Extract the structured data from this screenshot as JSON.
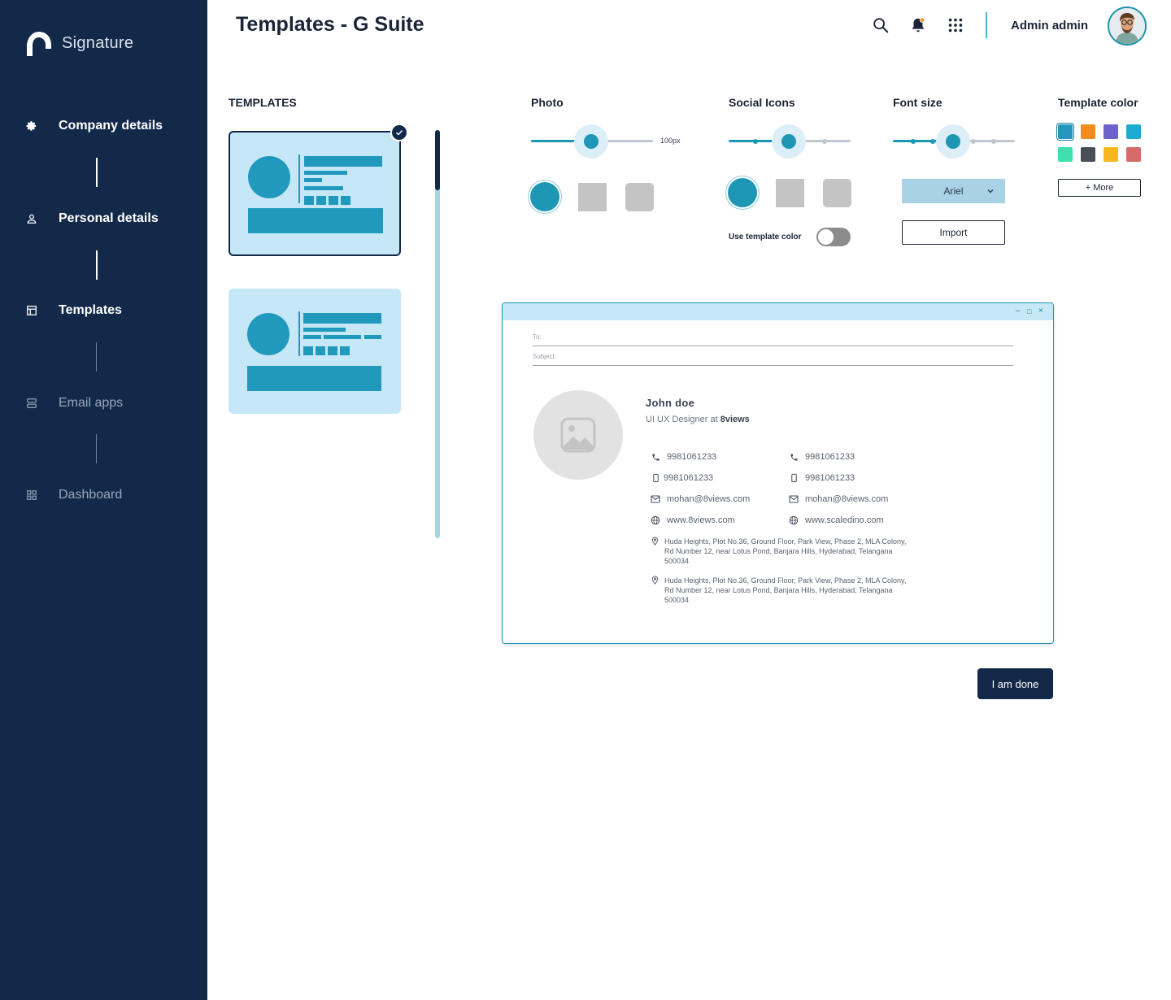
{
  "app": {
    "brand_name": "Signature",
    "page_title": "Templates - G Suite"
  },
  "header": {
    "user_name": "Admin admin",
    "icons": [
      "search-icon",
      "bell-icon",
      "apps-grid-icon"
    ],
    "notification_dot_color": "#f08c1e"
  },
  "sidebar": {
    "items": [
      {
        "label": "Company details",
        "icon": "gear-icon",
        "active": true
      },
      {
        "label": "Personal details",
        "icon": "person-icon",
        "active": true
      },
      {
        "label": "Templates",
        "icon": "layout-icon",
        "active": true
      },
      {
        "label": "Email apps",
        "icon": "storage-icon",
        "active": false
      },
      {
        "label": "Dashboard",
        "icon": "dashboard-icon",
        "active": false
      }
    ]
  },
  "templates": {
    "heading": "TEMPLATES",
    "selected_index": 0,
    "count_visible": 2
  },
  "photo": {
    "label": "Photo",
    "size_value": "100px",
    "slider_fraction": 0.49,
    "shapes": [
      "circle",
      "square",
      "rounded-square"
    ],
    "selected_shape": "circle"
  },
  "social_icons": {
    "label": "Social Icons",
    "slider_step": 2,
    "slider_steps_total": 4,
    "shapes": [
      "circle",
      "square",
      "rounded-square"
    ],
    "selected_shape": "circle",
    "toggle_label": "Use template color",
    "toggle_on": false
  },
  "font_size": {
    "label": "Font size",
    "slider_step": 3,
    "slider_steps_total": 6,
    "font_select_value": "Ariel",
    "import_label": "Import"
  },
  "template_color": {
    "label": "Template color",
    "colors": [
      "#2596be",
      "#f08c1e",
      "#6b63c9",
      "#1eabd0",
      "#3ee0b0",
      "#4a4f57",
      "#f6b81e",
      "#d46a6a"
    ],
    "selected_index": 0,
    "more_label": "+ More"
  },
  "email_preview": {
    "window_controls": [
      "–",
      "□",
      "×"
    ],
    "to_label": "To:",
    "subject_label": "Subject:",
    "signature": {
      "name": "John doe",
      "role_prefix": "UI UX Designer at ",
      "company": "8views",
      "col1": {
        "phone": "9981061233",
        "mobile": "9981061233",
        "email": "mohan@8views.com",
        "web": "www.8views.com"
      },
      "col2": {
        "phone": "9981061233",
        "mobile": "9981061233",
        "email": "mohan@8views.com",
        "web": "www.scaledino.com"
      },
      "address_1": "Huda Heights, Plot No.36, Ground Floor, Park View, Phase 2, MLA Colony, Rd Number 12, near Lotus Pond, Banjara Hills, Hyderabad, Telangana 500034",
      "address_2": "Huda Heights, Plot No.36, Ground Floor, Park View, Phase 2, MLA Colony, Rd Number 12, near Lotus Pond, Banjara Hills, Hyderabad, Telangana 500034"
    }
  },
  "actions": {
    "done_label": "I am done"
  },
  "colors": {
    "sidebar_bg": "#13294a",
    "accent": "#1e97b5",
    "card_bg": "#c6e8f6"
  }
}
